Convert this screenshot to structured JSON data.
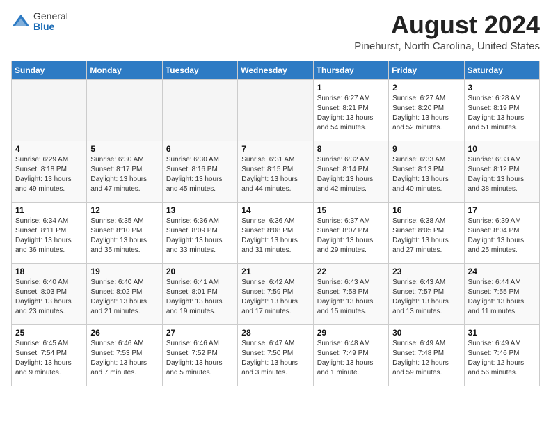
{
  "header": {
    "logo_general": "General",
    "logo_blue": "Blue",
    "title": "August 2024",
    "subtitle": "Pinehurst, North Carolina, United States"
  },
  "weekdays": [
    "Sunday",
    "Monday",
    "Tuesday",
    "Wednesday",
    "Thursday",
    "Friday",
    "Saturday"
  ],
  "weeks": [
    [
      {
        "day": "",
        "info": ""
      },
      {
        "day": "",
        "info": ""
      },
      {
        "day": "",
        "info": ""
      },
      {
        "day": "",
        "info": ""
      },
      {
        "day": "1",
        "info": "Sunrise: 6:27 AM\nSunset: 8:21 PM\nDaylight: 13 hours\nand 54 minutes."
      },
      {
        "day": "2",
        "info": "Sunrise: 6:27 AM\nSunset: 8:20 PM\nDaylight: 13 hours\nand 52 minutes."
      },
      {
        "day": "3",
        "info": "Sunrise: 6:28 AM\nSunset: 8:19 PM\nDaylight: 13 hours\nand 51 minutes."
      }
    ],
    [
      {
        "day": "4",
        "info": "Sunrise: 6:29 AM\nSunset: 8:18 PM\nDaylight: 13 hours\nand 49 minutes."
      },
      {
        "day": "5",
        "info": "Sunrise: 6:30 AM\nSunset: 8:17 PM\nDaylight: 13 hours\nand 47 minutes."
      },
      {
        "day": "6",
        "info": "Sunrise: 6:30 AM\nSunset: 8:16 PM\nDaylight: 13 hours\nand 45 minutes."
      },
      {
        "day": "7",
        "info": "Sunrise: 6:31 AM\nSunset: 8:15 PM\nDaylight: 13 hours\nand 44 minutes."
      },
      {
        "day": "8",
        "info": "Sunrise: 6:32 AM\nSunset: 8:14 PM\nDaylight: 13 hours\nand 42 minutes."
      },
      {
        "day": "9",
        "info": "Sunrise: 6:33 AM\nSunset: 8:13 PM\nDaylight: 13 hours\nand 40 minutes."
      },
      {
        "day": "10",
        "info": "Sunrise: 6:33 AM\nSunset: 8:12 PM\nDaylight: 13 hours\nand 38 minutes."
      }
    ],
    [
      {
        "day": "11",
        "info": "Sunrise: 6:34 AM\nSunset: 8:11 PM\nDaylight: 13 hours\nand 36 minutes."
      },
      {
        "day": "12",
        "info": "Sunrise: 6:35 AM\nSunset: 8:10 PM\nDaylight: 13 hours\nand 35 minutes."
      },
      {
        "day": "13",
        "info": "Sunrise: 6:36 AM\nSunset: 8:09 PM\nDaylight: 13 hours\nand 33 minutes."
      },
      {
        "day": "14",
        "info": "Sunrise: 6:36 AM\nSunset: 8:08 PM\nDaylight: 13 hours\nand 31 minutes."
      },
      {
        "day": "15",
        "info": "Sunrise: 6:37 AM\nSunset: 8:07 PM\nDaylight: 13 hours\nand 29 minutes."
      },
      {
        "day": "16",
        "info": "Sunrise: 6:38 AM\nSunset: 8:05 PM\nDaylight: 13 hours\nand 27 minutes."
      },
      {
        "day": "17",
        "info": "Sunrise: 6:39 AM\nSunset: 8:04 PM\nDaylight: 13 hours\nand 25 minutes."
      }
    ],
    [
      {
        "day": "18",
        "info": "Sunrise: 6:40 AM\nSunset: 8:03 PM\nDaylight: 13 hours\nand 23 minutes."
      },
      {
        "day": "19",
        "info": "Sunrise: 6:40 AM\nSunset: 8:02 PM\nDaylight: 13 hours\nand 21 minutes."
      },
      {
        "day": "20",
        "info": "Sunrise: 6:41 AM\nSunset: 8:01 PM\nDaylight: 13 hours\nand 19 minutes."
      },
      {
        "day": "21",
        "info": "Sunrise: 6:42 AM\nSunset: 7:59 PM\nDaylight: 13 hours\nand 17 minutes."
      },
      {
        "day": "22",
        "info": "Sunrise: 6:43 AM\nSunset: 7:58 PM\nDaylight: 13 hours\nand 15 minutes."
      },
      {
        "day": "23",
        "info": "Sunrise: 6:43 AM\nSunset: 7:57 PM\nDaylight: 13 hours\nand 13 minutes."
      },
      {
        "day": "24",
        "info": "Sunrise: 6:44 AM\nSunset: 7:55 PM\nDaylight: 13 hours\nand 11 minutes."
      }
    ],
    [
      {
        "day": "25",
        "info": "Sunrise: 6:45 AM\nSunset: 7:54 PM\nDaylight: 13 hours\nand 9 minutes."
      },
      {
        "day": "26",
        "info": "Sunrise: 6:46 AM\nSunset: 7:53 PM\nDaylight: 13 hours\nand 7 minutes."
      },
      {
        "day": "27",
        "info": "Sunrise: 6:46 AM\nSunset: 7:52 PM\nDaylight: 13 hours\nand 5 minutes."
      },
      {
        "day": "28",
        "info": "Sunrise: 6:47 AM\nSunset: 7:50 PM\nDaylight: 13 hours\nand 3 minutes."
      },
      {
        "day": "29",
        "info": "Sunrise: 6:48 AM\nSunset: 7:49 PM\nDaylight: 13 hours\nand 1 minute."
      },
      {
        "day": "30",
        "info": "Sunrise: 6:49 AM\nSunset: 7:48 PM\nDaylight: 12 hours\nand 59 minutes."
      },
      {
        "day": "31",
        "info": "Sunrise: 6:49 AM\nSunset: 7:46 PM\nDaylight: 12 hours\nand 56 minutes."
      }
    ]
  ]
}
